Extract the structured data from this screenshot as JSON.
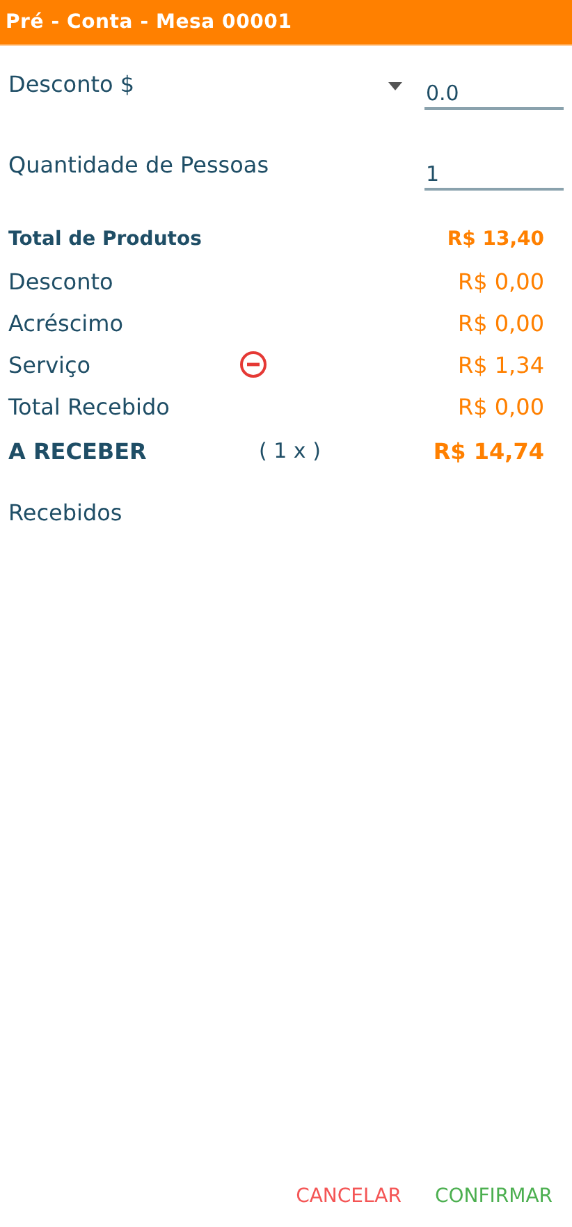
{
  "header": {
    "title": "Pré - Conta - Mesa 00001"
  },
  "fields": [
    {
      "label": "Desconto $",
      "value": "0.0",
      "dropdown": true
    },
    {
      "label": "Quantidade de Pessoas",
      "value": "1",
      "dropdown": false
    }
  ],
  "summary": [
    {
      "kind": "bold",
      "label": "Total de Produtos",
      "value": "R$ 13,40"
    },
    {
      "kind": "plain",
      "label": "Desconto",
      "value": "R$ 0,00"
    },
    {
      "kind": "plain",
      "label": "Acréscimo",
      "value": "R$ 0,00"
    },
    {
      "kind": "plain",
      "label": "Serviço",
      "value": "R$ 1,34",
      "removable": true
    },
    {
      "kind": "plain",
      "label": "Total Recebido",
      "value": "R$ 0,00"
    },
    {
      "kind": "due",
      "label": "A RECEBER",
      "value": "R$ 14,74",
      "multiplier": "( 1 x )"
    }
  ],
  "received": {
    "title": "Recebidos"
  },
  "buttons": [
    {
      "label": "CANCELAR",
      "kind": "cancel"
    },
    {
      "label": "CONFIRMAR",
      "kind": "confirm"
    }
  ]
}
